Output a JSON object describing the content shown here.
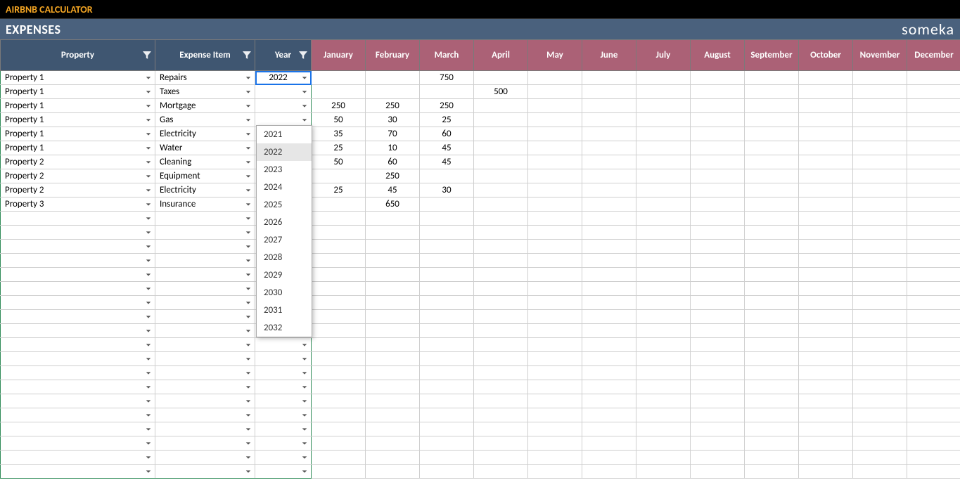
{
  "title": "AIRBNB CALCULATOR",
  "section": "EXPENSES",
  "brand": "someka",
  "headers": {
    "property": "Property",
    "expense": "Expense Item",
    "year": "Year",
    "months": [
      "January",
      "February",
      "March",
      "April",
      "May",
      "June",
      "July",
      "August",
      "September",
      "October",
      "November",
      "December"
    ]
  },
  "active_year": "2022",
  "dropdown_years": [
    "2021",
    "2022",
    "2023",
    "2024",
    "2025",
    "2026",
    "2027",
    "2028",
    "2029",
    "2030",
    "2031",
    "2032"
  ],
  "dropdown_selected": "2022",
  "rows": [
    {
      "property": "Property 1",
      "expense": "Repairs",
      "year": "2022",
      "vals": [
        "",
        "",
        "750",
        "",
        "",
        "",
        "",
        "",
        "",
        "",
        "",
        ""
      ]
    },
    {
      "property": "Property 1",
      "expense": "Taxes",
      "year": "",
      "vals": [
        "",
        "",
        "",
        "500",
        "",
        "",
        "",
        "",
        "",
        "",
        "",
        ""
      ]
    },
    {
      "property": "Property 1",
      "expense": "Mortgage",
      "year": "",
      "vals": [
        "250",
        "250",
        "250",
        "",
        "",
        "",
        "",
        "",
        "",
        "",
        "",
        ""
      ]
    },
    {
      "property": "Property 1",
      "expense": "Gas",
      "year": "",
      "vals": [
        "50",
        "30",
        "25",
        "",
        "",
        "",
        "",
        "",
        "",
        "",
        "",
        ""
      ]
    },
    {
      "property": "Property 1",
      "expense": "Electricity",
      "year": "",
      "vals": [
        "35",
        "70",
        "60",
        "",
        "",
        "",
        "",
        "",
        "",
        "",
        "",
        ""
      ]
    },
    {
      "property": "Property 1",
      "expense": "Water",
      "year": "",
      "vals": [
        "25",
        "10",
        "45",
        "",
        "",
        "",
        "",
        "",
        "",
        "",
        "",
        ""
      ]
    },
    {
      "property": "Property 2",
      "expense": "Cleaning",
      "year": "",
      "vals": [
        "50",
        "60",
        "45",
        "",
        "",
        "",
        "",
        "",
        "",
        "",
        "",
        ""
      ]
    },
    {
      "property": "Property 2",
      "expense": "Equipment",
      "year": "",
      "vals": [
        "",
        "250",
        "",
        "",
        "",
        "",
        "",
        "",
        "",
        "",
        "",
        ""
      ]
    },
    {
      "property": "Property 2",
      "expense": "Electricity",
      "year": "",
      "vals": [
        "25",
        "45",
        "30",
        "",
        "",
        "",
        "",
        "",
        "",
        "",
        "",
        ""
      ]
    },
    {
      "property": "Property 3",
      "expense": "Insurance",
      "year": "",
      "vals": [
        "",
        "650",
        "",
        "",
        "",
        "",
        "",
        "",
        "",
        "",
        "",
        ""
      ]
    }
  ],
  "empty_row_count": 19
}
